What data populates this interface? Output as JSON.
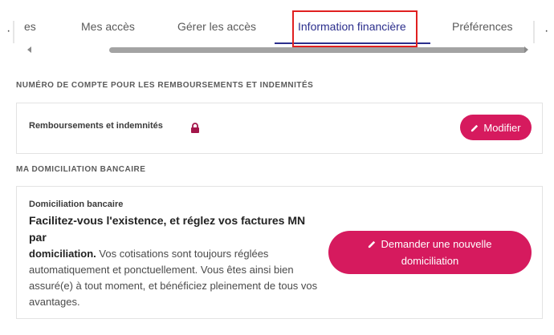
{
  "tabs": {
    "items": [
      {
        "label": "es"
      },
      {
        "label": "Mes accès"
      },
      {
        "label": "Gérer les accès"
      },
      {
        "label": "Information financière"
      },
      {
        "label": "Préférences"
      }
    ],
    "active_index": 3
  },
  "sections": {
    "refund": {
      "title": "NUMÉRO DE COMPTE POUR LES REMBOURSEMENTS ET INDEMNITÉS",
      "card_label": "Remboursements et indemnités",
      "edit_button": "Modifier"
    },
    "domiciliation": {
      "title": "MA DOMICILIATION BANCAIRE",
      "card_label": "Domiciliation bancaire",
      "lead_line1": "Facilitez-vous l'existence, et réglez vos factures MN par",
      "lead_line2": "domiciliation.",
      "body": " Vos cotisations sont toujours réglées automatiquement et ponctuellement. Vous êtes ainsi bien assuré(e) à tout moment, et bénéficiez pleinement de tous vos avantages.",
      "request_button_line1": "Demander une nouvelle",
      "request_button_line2": "domiciliation"
    }
  },
  "colors": {
    "accent": "#d61a5e",
    "active_tab": "#2b2e8c",
    "highlight": "#e02020"
  },
  "icons": [
    "pencil-icon",
    "lock-icon"
  ]
}
